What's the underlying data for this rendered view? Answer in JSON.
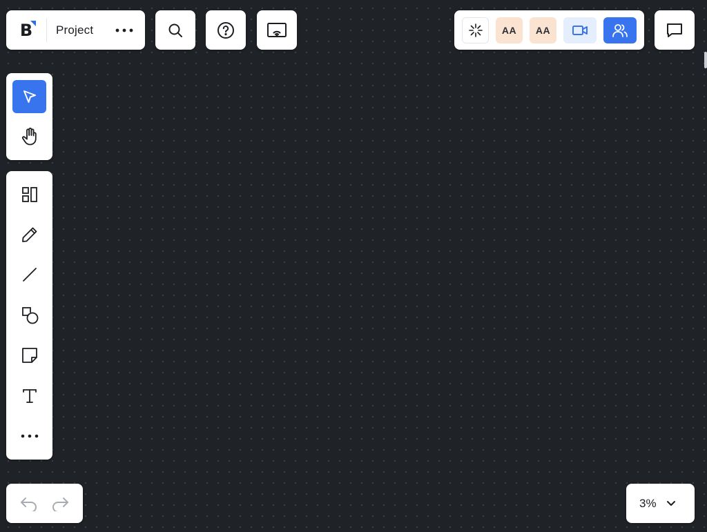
{
  "app": {
    "logo_letter": "B"
  },
  "project": {
    "name": "Project"
  },
  "collaboration": {
    "avatars": [
      {
        "initials": "AA"
      },
      {
        "initials": "AA"
      }
    ]
  },
  "toolbar": {
    "navigation": [
      "select-tool",
      "hand-tool"
    ],
    "active_tool": "select-tool",
    "tools": [
      "templates-tool",
      "pen-tool",
      "line-tool",
      "shapes-tool",
      "sticky-note-tool",
      "text-tool",
      "more-tools"
    ]
  },
  "zoom": {
    "value": "3%"
  },
  "colors": {
    "canvas_background": "#1f2227",
    "canvas_dot": "#3c414a",
    "accent": "#3774ee",
    "brand": "#2a6ee8",
    "avatar_background": "#fbe3d2",
    "video_background": "#e4eefd"
  }
}
